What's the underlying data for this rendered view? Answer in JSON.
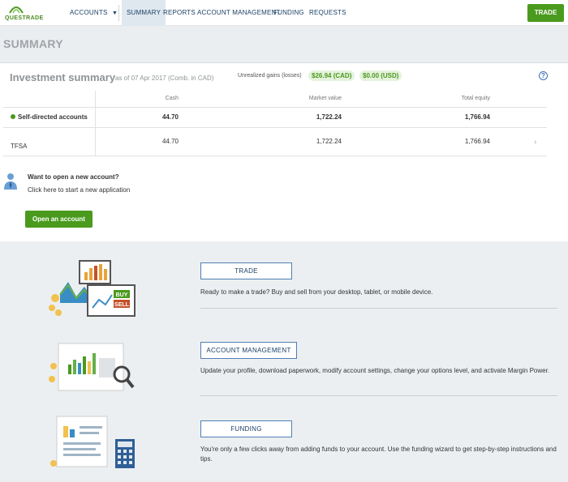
{
  "nav": {
    "logo_text": "QUESTRADE",
    "accounts": "ACCOUNTS",
    "accounts_caret": "▼",
    "summary": "SUMMARY",
    "reports": "REPORTS",
    "account_management": "ACCOUNT MANAGEMENT",
    "funding": "FUNDING",
    "requests": "REQUESTS",
    "trade_button": "TRADE"
  },
  "page_title": "SUMMARY",
  "investment": {
    "title": "Investment summary",
    "subtitle": "as of 07 Apr 2017 (Comb. in CAD)",
    "gains_label": "Unrealized gains (losses)",
    "gains_cad": "$26.94 (CAD)",
    "gains_usd": "$0.00 (USD)",
    "help": "?",
    "columns": [
      "Cash",
      "Market value",
      "Total equity"
    ],
    "rows": [
      {
        "label": "Self-directed accounts",
        "cash": "44.70",
        "market_value": "1,722.24",
        "total_equity": "1,766.94"
      },
      {
        "label": "TFSA",
        "cash": "44.70",
        "market_value": "1,722.24",
        "total_equity": "1,766.94"
      }
    ],
    "row_chevron": "›"
  },
  "new_account": {
    "title": "Want to open a new account?",
    "subtitle": "Click here to start a new application",
    "button": "Open an account"
  },
  "sections": [
    {
      "button": "TRADE",
      "text": "Ready to make a trade? Buy and sell from your desktop, tablet, or mobile device."
    },
    {
      "button": "ACCOUNT MANAGEMENT",
      "text": "Update your profile, download paperwork, modify account settings, change your options level, and activate Margin Power."
    },
    {
      "button": "FUNDING",
      "text": "You're only a few clicks away from adding funds to your account. Use the funding wizard to get step-by-step instructions and tips."
    }
  ],
  "illustration": {
    "buy_label": "BUY",
    "sell_label": "SELL"
  },
  "colors": {
    "brand_green": "#4a9a1e",
    "nav_blue": "#1a3f66",
    "outline_blue": "#4f7fb5",
    "section_bg": "#eceff1"
  }
}
